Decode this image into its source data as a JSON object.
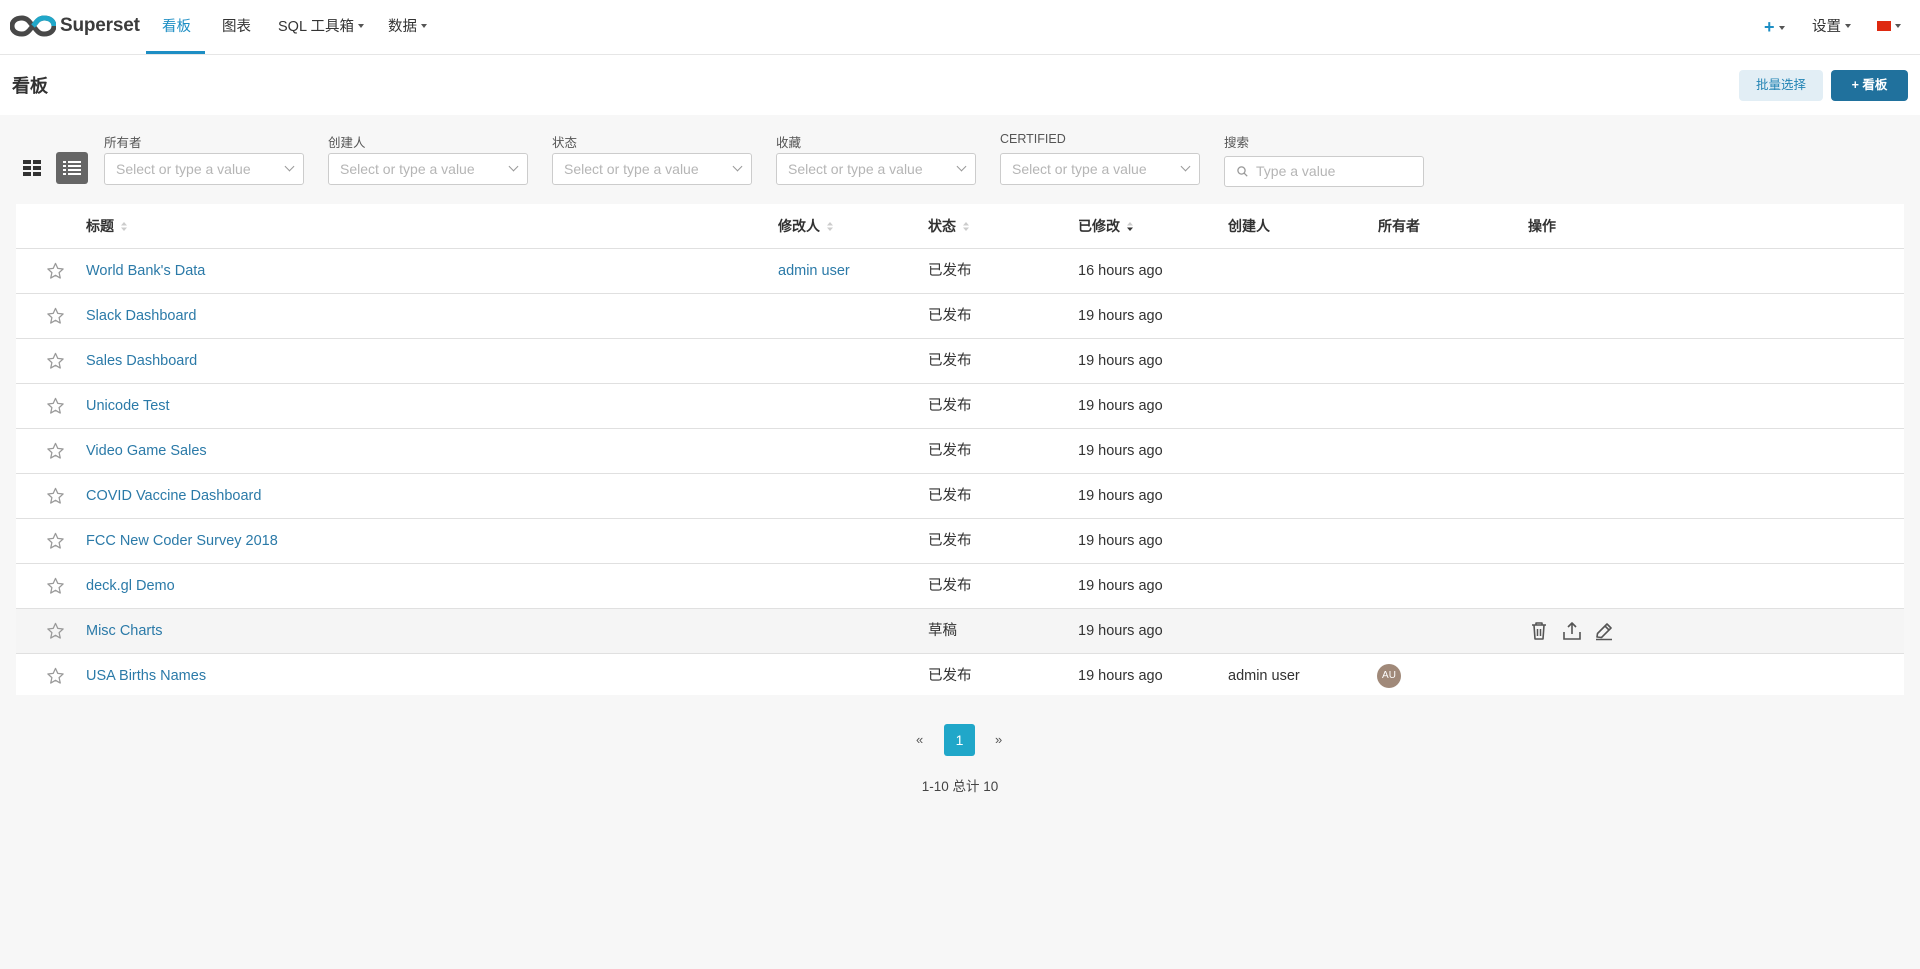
{
  "navbar": {
    "brand": "Superset",
    "items": [
      {
        "label": "看板"
      },
      {
        "label": "图表"
      },
      {
        "label": "SQL 工具箱"
      },
      {
        "label": "数据"
      }
    ],
    "new_symbol": "+",
    "settings_label": "设置",
    "language_flag": "cn-flag-icon",
    "accent_color": "#1d8ec4"
  },
  "page": {
    "title": "看板",
    "bulk_select_label": "批量选择",
    "new_dashboard_label": "+ 看板"
  },
  "filters": {
    "owner": {
      "label": "所有者",
      "placeholder": "Select or type a value"
    },
    "creator": {
      "label": "创建人",
      "placeholder": "Select or type a value"
    },
    "status": {
      "label": "状态",
      "placeholder": "Select or type a value"
    },
    "favorite": {
      "label": "收藏",
      "placeholder": "Select or type a value"
    },
    "certified": {
      "label": "CERTIFIED",
      "placeholder": "Select or type a value"
    },
    "search": {
      "label": "搜索",
      "placeholder": "Type a value"
    }
  },
  "table": {
    "columns": {
      "title": "标题",
      "modified_by": "修改人",
      "status": "状态",
      "modified": "已修改",
      "created_by": "创建人",
      "owners": "所有者",
      "actions": "操作"
    },
    "rows": [
      {
        "title": "World Bank's Data",
        "modified_by": "admin user",
        "status": "已发布",
        "modified": "16 hours ago",
        "created_by": "",
        "owner": ""
      },
      {
        "title": "Slack Dashboard",
        "modified_by": "",
        "status": "已发布",
        "modified": "19 hours ago",
        "created_by": "",
        "owner": ""
      },
      {
        "title": "Sales Dashboard",
        "modified_by": "",
        "status": "已发布",
        "modified": "19 hours ago",
        "created_by": "",
        "owner": ""
      },
      {
        "title": "Unicode Test",
        "modified_by": "",
        "status": "已发布",
        "modified": "19 hours ago",
        "created_by": "",
        "owner": ""
      },
      {
        "title": "Video Game Sales",
        "modified_by": "",
        "status": "已发布",
        "modified": "19 hours ago",
        "created_by": "",
        "owner": ""
      },
      {
        "title": "COVID Vaccine Dashboard",
        "modified_by": "",
        "status": "已发布",
        "modified": "19 hours ago",
        "created_by": "",
        "owner": ""
      },
      {
        "title": "FCC New Coder Survey 2018",
        "modified_by": "",
        "status": "已发布",
        "modified": "19 hours ago",
        "created_by": "",
        "owner": ""
      },
      {
        "title": "deck.gl Demo",
        "modified_by": "",
        "status": "已发布",
        "modified": "19 hours ago",
        "created_by": "",
        "owner": ""
      },
      {
        "title": "Misc Charts",
        "modified_by": "",
        "status": "草稿",
        "modified": "19 hours ago",
        "created_by": "",
        "owner": ""
      },
      {
        "title": "USA Births Names",
        "modified_by": "",
        "status": "已发布",
        "modified": "19 hours ago",
        "created_by": "admin user",
        "owner": "AU"
      }
    ]
  },
  "pagination": {
    "prev": "«",
    "current": "1",
    "next": "»",
    "summary": "1-10 总计 10"
  }
}
